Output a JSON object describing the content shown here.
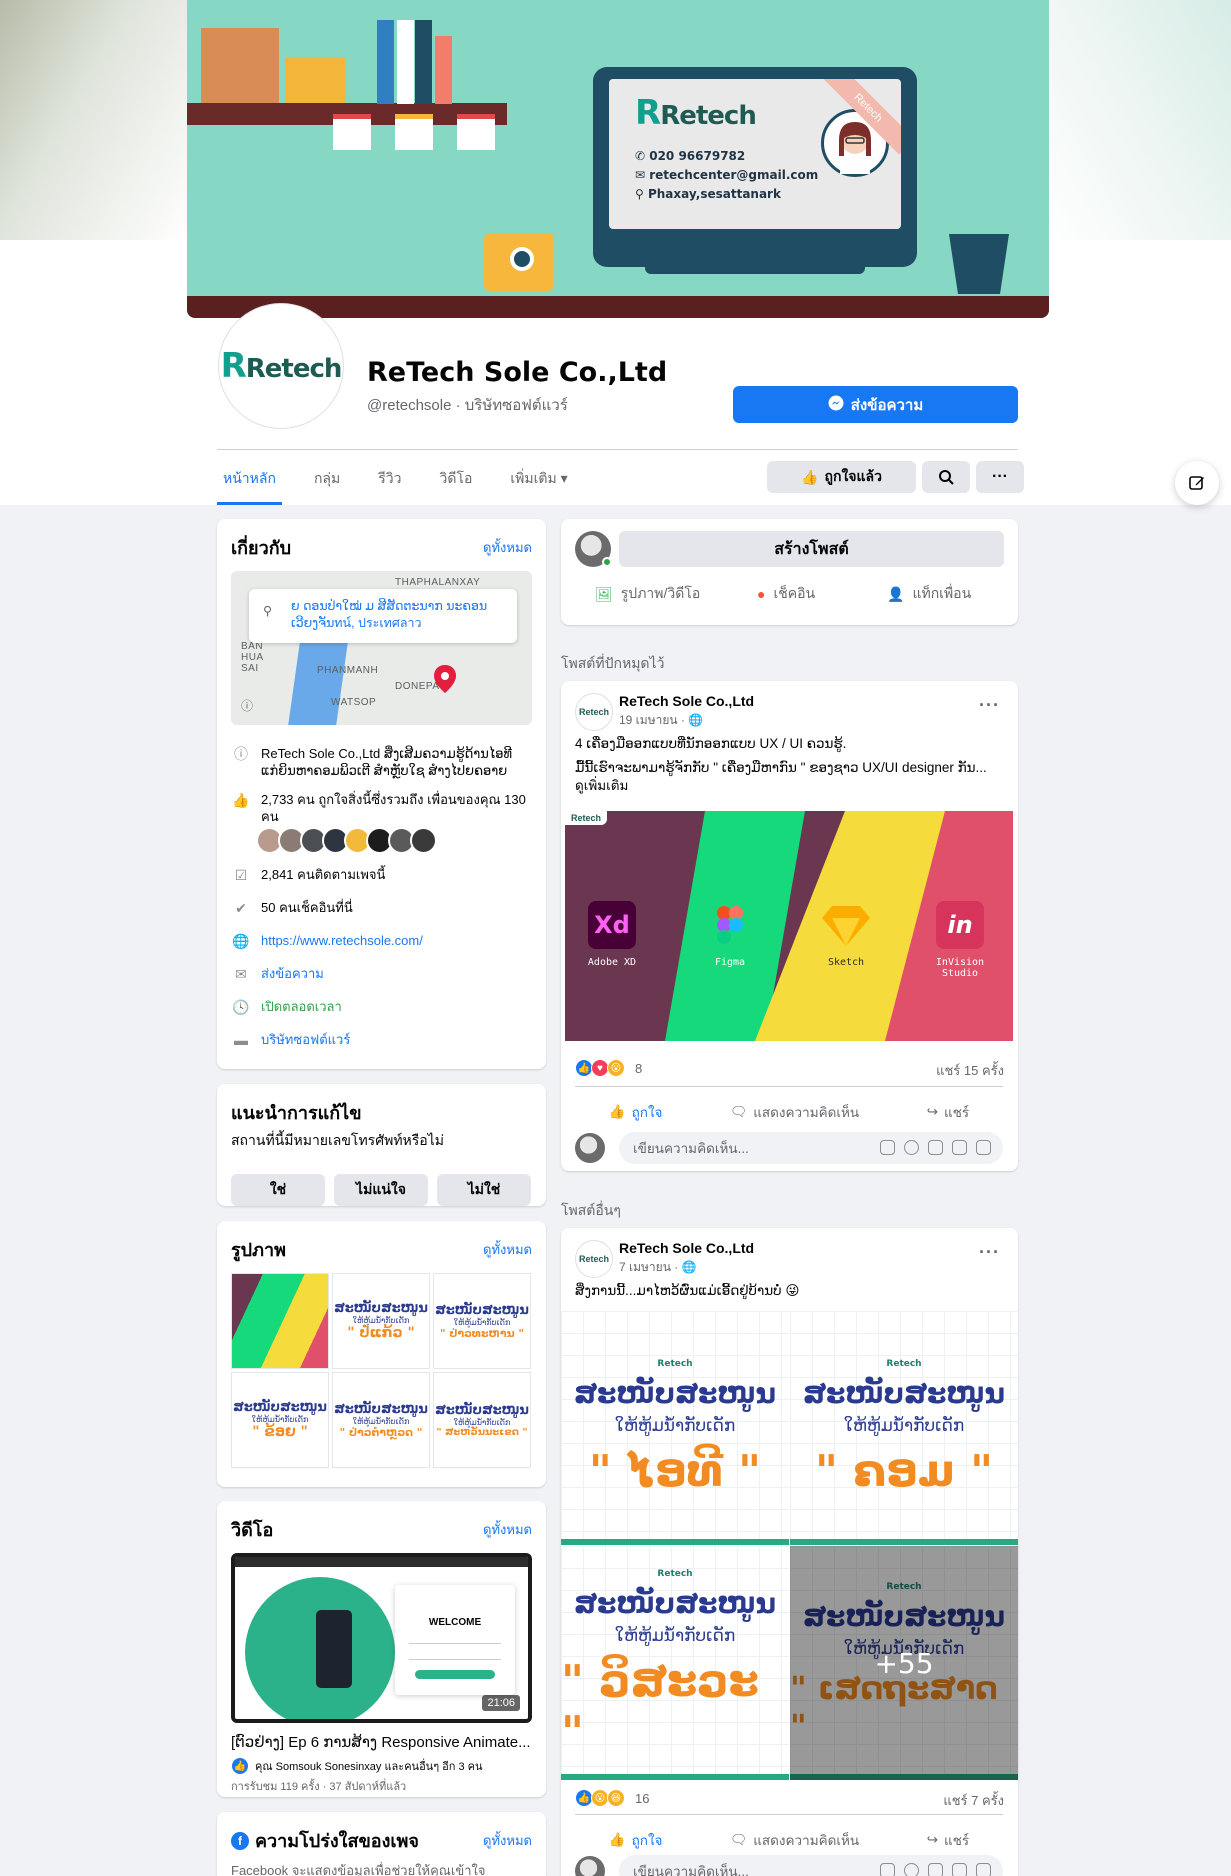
{
  "cover": {
    "brand": "Retech",
    "phone": "020 96679782",
    "email": "retechcenter@gmail.com",
    "address": "Phaxay,sesattanark",
    "ribbon": "Retech"
  },
  "page": {
    "logo_text": "Retech",
    "name": "ReTech Sole Co.,Ltd",
    "handle": "@retechsole · บริษัทซอฟต์แวร์",
    "message_button": "ส่งข้อความ"
  },
  "tabs": [
    {
      "label": "หน้าหลัก",
      "active": true
    },
    {
      "label": "กลุ่ม"
    },
    {
      "label": "รีวิว"
    },
    {
      "label": "วิดีโอ"
    },
    {
      "label": "เพิ่มเติม ▾"
    }
  ],
  "toolbar": {
    "like_label": "ถูกใจแล้ว"
  },
  "about": {
    "title": "เกี่ยวกับ",
    "see_all": "ดูทั้งหมด",
    "map_address": "ຍ ດອນປ່າໃໝ່ ມ ສີສັດຕະນາກ ນະຄອນ ເວີຍງຈັນทน์, ประเทศลาว",
    "map_labels": [
      "THAPHALANXAY",
      "BAN HUA SAI",
      "PHANMANH",
      "DONEPA",
      "WATSOP"
    ],
    "description": "ReTech Sole Co.,Ltd ສິ່ງເສີມຄວາມຮູ້ດ້ານໄອທີ ແກ່ຍິນຫາຄອມພິວເຕີ ສຳຫຼັບໃຊ ສຳງໄປຍຄອາຍ",
    "likes": "2,733 คน ถูกใจสิ่งนี้ซึ่งรวมถึง เพื่อนของคุณ 130 คน",
    "followers": "2,841 คนติดตามเพจนี้",
    "checkins": "50 คนเช็คอินที่นี่",
    "website": "https://www.retechsole.com/",
    "send_message": "ส่งข้อความ",
    "hours": "เปิดตลอดเวลา",
    "category": "บริษัทซอฟต์แวร์"
  },
  "suggest": {
    "title": "แนะนำการแก้ไข",
    "question": "สถานที่นี้มีหมายเลขโทรศัพท์หรือไม่",
    "yes": "ใช่",
    "unsure": "ไม่แน่ใจ",
    "no": "ไม่ใช่"
  },
  "photos": {
    "title": "รูปภาพ",
    "see_all": "ดูทั้งหมด",
    "tiles": [
      {
        "heading": "",
        "sub": "",
        "name": ""
      },
      {
        "heading": "ສະໜັບສະໜູນ",
        "sub": "ໃຫ້ຫູ້ມນໍ້າກັບເດັກ",
        "name": "\" ປໍ່ແກ້ວ \""
      },
      {
        "heading": "ສະໜັບສະໜູນ",
        "sub": "ໃຫ້ຫູ້ມນໍ້າກັບເດັກ",
        "name": "\" ປ່າວທະຫານ \""
      },
      {
        "heading": "ສະໜັບສະໜູນ",
        "sub": "ໃຫ້ຫູ້ມນໍ້າກັບເດັກ",
        "name": "\" ຂ້ອຍ \""
      },
      {
        "heading": "ສະໜັບສະໜູນ",
        "sub": "ໃຫ້ຫູ້ມນໍ້າກັບເດັກ",
        "name": "\" ປ່າວຕຳຫຼວດ \""
      },
      {
        "heading": "ສະໜັບສະໜູນ",
        "sub": "ໃຫ້ຫູ້ມນໍ້າກັບເດັກ",
        "name": "\" ສະຫວັນນະເຂດ \""
      }
    ]
  },
  "video": {
    "title": "วิดีโอ",
    "see_all": "ดูทั้งหมด",
    "welcome": "WELCOME",
    "duration": "21:06",
    "caption": "[ຕົວຢ່າງ] Ep 6 ການສ້າງ Responsive Animate...",
    "liked_by": "คุณ Somsouk Sonesinxay และคนอื่นๆ อีก 3 คน",
    "stats": "การรับชม 119 ครั้ง · 37 สัปดาห์ที่แล้ว"
  },
  "transparency": {
    "title": "ความโปร่งใสของเพจ",
    "see_all": "ดูทั้งหมด",
    "text": "Facebook จะแสดงข้อมูลเพื่อช่วยให้คุณเข้าใจ"
  },
  "composer": {
    "button": "สร้างโพสต์",
    "photo": "รูปภาพ/วิดีโอ",
    "checkin": "เช็คอิน",
    "tag": "แท็กเพื่อน"
  },
  "labels": {
    "pinned": "โพสต์ที่ปักหมุดไว้",
    "other": "โพสต์อื่นๆ"
  },
  "post1": {
    "author": "ReTech Sole Co.,Ltd",
    "time": "19 เมษายน · 🌐",
    "line1": "4 ເຄື່ອງມືອອກແບບທີ່ນັກອອກແບບ UX / UI ຄວນຮູ້.",
    "line2": "ມື້ນີ້ເຮົາຈະພາມາຮູ້ຈັກກັບ \" ເຄື່ອງມືຫາກົນ \" ຂອງຊາວ UX/UI designer ກັນ... ดูเพิ่มเติม",
    "tools": [
      {
        "icon": "Xd",
        "name": "Adobe XD"
      },
      {
        "icon": "",
        "name": "Figma"
      },
      {
        "icon": "",
        "name": "Sketch"
      },
      {
        "icon": "in",
        "name": "InVision Studio"
      }
    ],
    "reaction_count": "8",
    "shares": "แชร์ 15 ครั้ง"
  },
  "post2": {
    "author": "ReTech Sole Co.,Ltd",
    "time": "7 เมษายน · 🌐",
    "line1": "ສິ່ງການນີ້...ມາໄຫວ້ຜົ່ນແມ່ເອີ້ດຢູ່ບ້ານບໍ່ 😜",
    "images": [
      {
        "logo": "Retech",
        "heading": "ສະໜັບສະໜູນ",
        "sub": "ໃຫ້ຫູ້ມນໍ້າກັບເດັກ",
        "name": "\" ໄອທີ \""
      },
      {
        "logo": "Retech",
        "heading": "ສະໜັບສະໜູນ",
        "sub": "ໃຫ້ຫູ້ມນໍ້າກັບເດັກ",
        "name": "\" ຄອມ \""
      },
      {
        "logo": "Retech",
        "heading": "ສະໜັບສະໜູນ",
        "sub": "ໃຫ້ຫູ້ມນໍ້າກັບເດັກ",
        "name": "\" ວິສະວະ \""
      },
      {
        "logo": "Retech",
        "heading": "ສະໜັບສະໜູນ",
        "sub": "ໃຫ້ຫູ້ມນໍ້າກັບເດັກ",
        "name": "\" ເສດຖະສາດ \""
      }
    ],
    "more_count": "+55",
    "reaction_count": "16",
    "shares": "แชร์ 7 ครั้ง"
  },
  "actions": {
    "like": "ถูกใจ",
    "comment": "แสดงความคิดเห็น",
    "share": "แชร์"
  },
  "comment_placeholder": "เขียนความคิดเห็น..."
}
